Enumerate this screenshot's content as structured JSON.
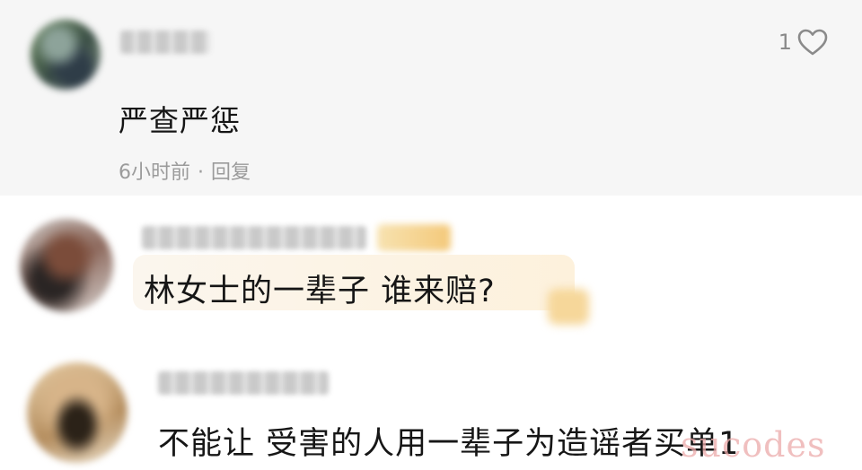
{
  "comments": [
    {
      "text": "严查严惩",
      "like_count": "1",
      "time": "6小时前",
      "separator": "·",
      "reply_label": "回复"
    },
    {
      "text": "林女士的一辈子 谁来赔?"
    },
    {
      "text": "不能让 受害的人用一辈子为造谣者买单1"
    }
  ],
  "watermark": "sucodes",
  "icons": {
    "like": "heart-outline-icon"
  },
  "colors": {
    "first_comment_bg": "#f6f6f6",
    "meta_text": "#9b9b9b",
    "bubble": "#fdf1dc"
  }
}
